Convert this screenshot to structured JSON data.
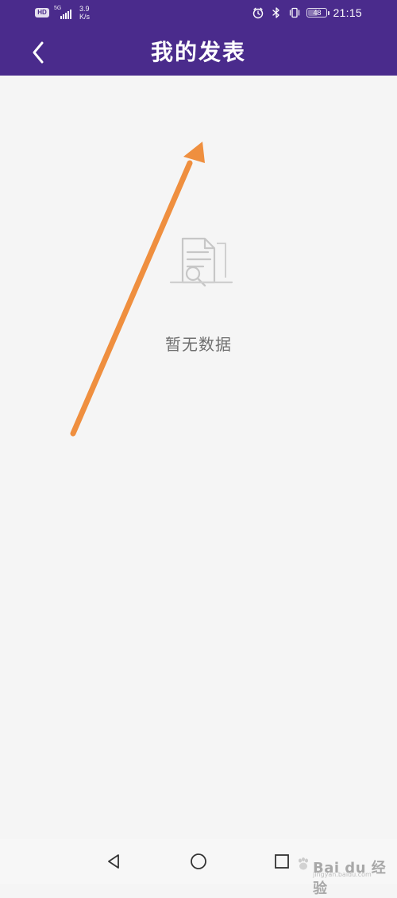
{
  "status_bar": {
    "network_tag": "HD",
    "signal_label": "5G",
    "speed_value": "3.9",
    "speed_unit": "K/s",
    "battery": "48",
    "time": "21:15",
    "icons": [
      "hd-icon",
      "signal-icon",
      "alarm-icon",
      "bluetooth-icon",
      "vibrate-icon",
      "battery-icon"
    ]
  },
  "header": {
    "title": "我的发表",
    "back_icon": "chevron-left-icon"
  },
  "content": {
    "empty_icon": "empty-document-search-icon",
    "empty_text": "暂无数据"
  },
  "annotation": {
    "arrow_color": "#ef8f3f"
  },
  "navbar": {
    "items": [
      "back-triangle-icon",
      "home-circle-icon",
      "recents-square-icon"
    ]
  },
  "watermark": {
    "brand": "Bai du 经验",
    "sub": "jingyan.baidu.com"
  },
  "colors": {
    "header_bg": "#4a2b8c",
    "page_bg": "#f5f5f5",
    "empty_text": "#6f6f6f"
  }
}
